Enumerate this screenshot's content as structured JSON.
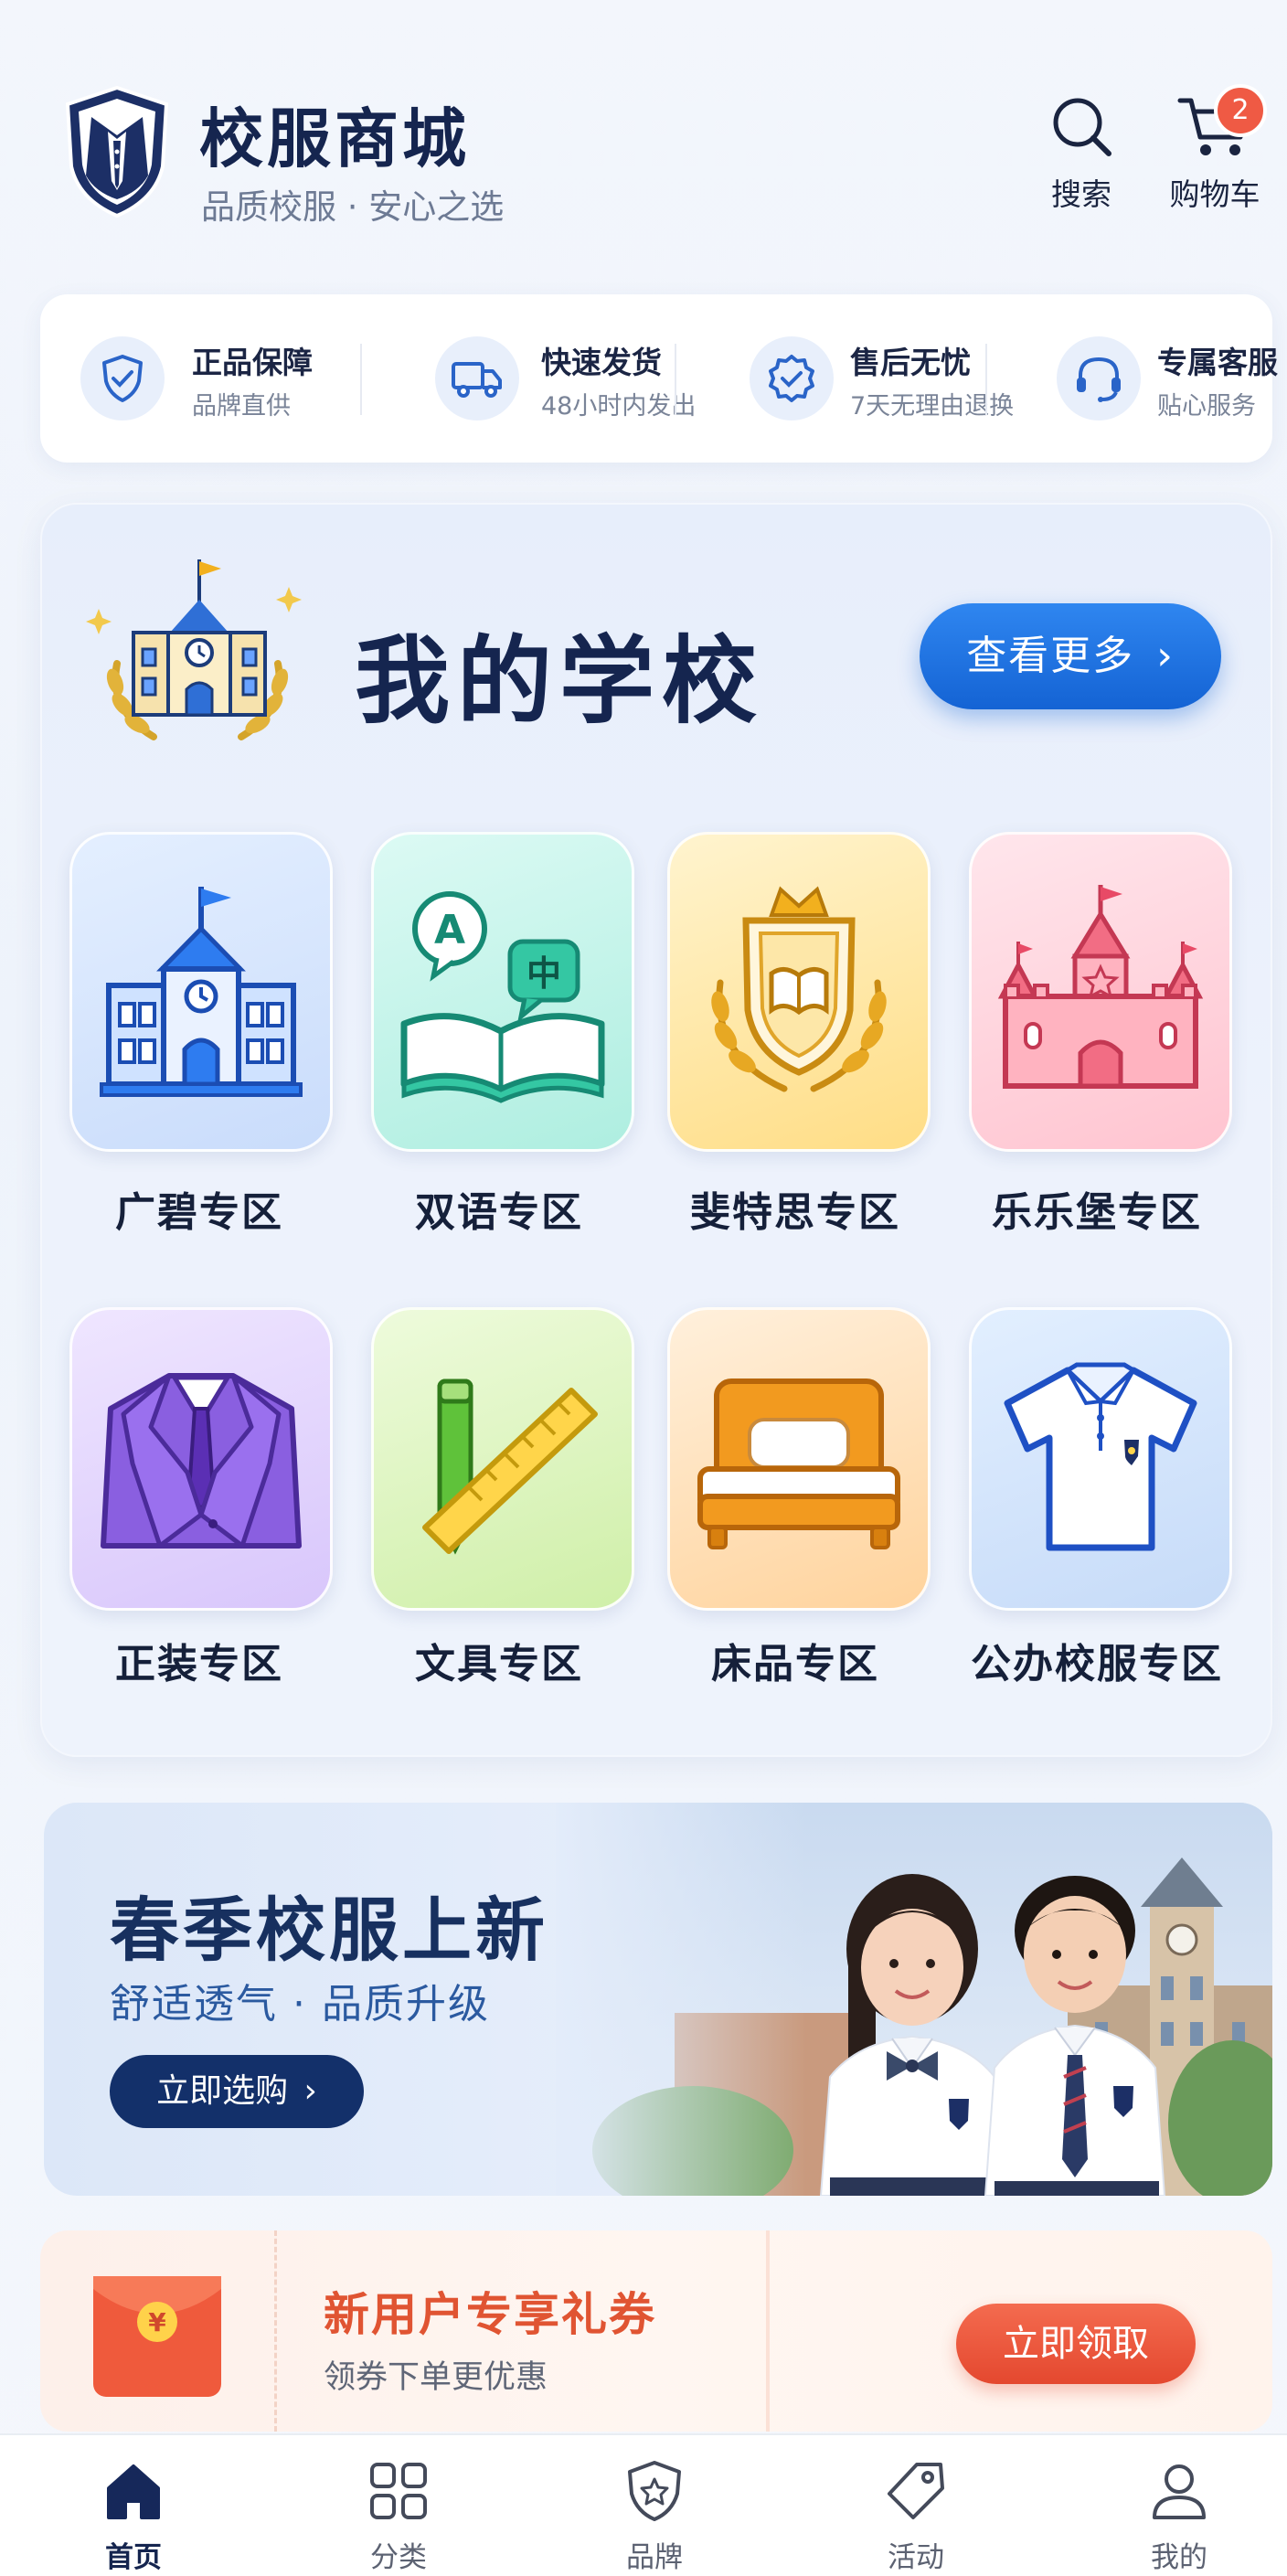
{
  "header": {
    "title": "校服商城",
    "subtitle": "品质校服 · 安心之选",
    "search_label": "搜索",
    "cart_label": "购物车",
    "cart_count": "2"
  },
  "guarantees": [
    {
      "title": "正品保障",
      "sub": "品牌直供",
      "icon": "shield-check-icon"
    },
    {
      "title": "快速发货",
      "sub": "48小时内发出",
      "icon": "truck-icon"
    },
    {
      "title": "售后无忧",
      "sub": "7天无理由退换",
      "icon": "badge-check-icon"
    },
    {
      "title": "专属客服",
      "sub": "贴心服务",
      "icon": "headset-icon"
    }
  ],
  "school": {
    "title": "我的学校",
    "more_label": "查看更多",
    "zones": [
      {
        "label": "广碧专区",
        "icon": "school-building-icon"
      },
      {
        "label": "双语专区",
        "icon": "bilingual-book-icon"
      },
      {
        "label": "斐特思专区",
        "icon": "crest-book-icon"
      },
      {
        "label": "乐乐堡专区",
        "icon": "castle-icon"
      },
      {
        "label": "正装专区",
        "icon": "suit-icon"
      },
      {
        "label": "文具专区",
        "icon": "pencil-ruler-icon"
      },
      {
        "label": "床品专区",
        "icon": "bed-icon"
      },
      {
        "label": "公办校服专区",
        "icon": "polo-shirt-icon"
      }
    ],
    "zone_bubble_a": "A",
    "zone_bubble_zh": "中"
  },
  "banner": {
    "title": "春季校服上新",
    "subtitle": "舒适透气 · 品质升级",
    "button": "立即选购"
  },
  "coupon": {
    "title": "新用户专享礼券",
    "subtitle": "领券下单更优惠",
    "button": "立即领取",
    "envelope_symbol": "¥"
  },
  "tabs": [
    {
      "label": "首页",
      "icon": "home-icon",
      "active": true
    },
    {
      "label": "分类",
      "icon": "grid-icon",
      "active": false
    },
    {
      "label": "品牌",
      "icon": "brand-shield-icon",
      "active": false
    },
    {
      "label": "活动",
      "icon": "tag-icon",
      "active": false
    },
    {
      "label": "我的",
      "icon": "user-icon",
      "active": false
    }
  ],
  "colors": {
    "brand_navy": "#15254f",
    "primary_blue": "#1463d4",
    "coupon_red": "#e4482f",
    "cart_badge": "#ef5a44"
  }
}
